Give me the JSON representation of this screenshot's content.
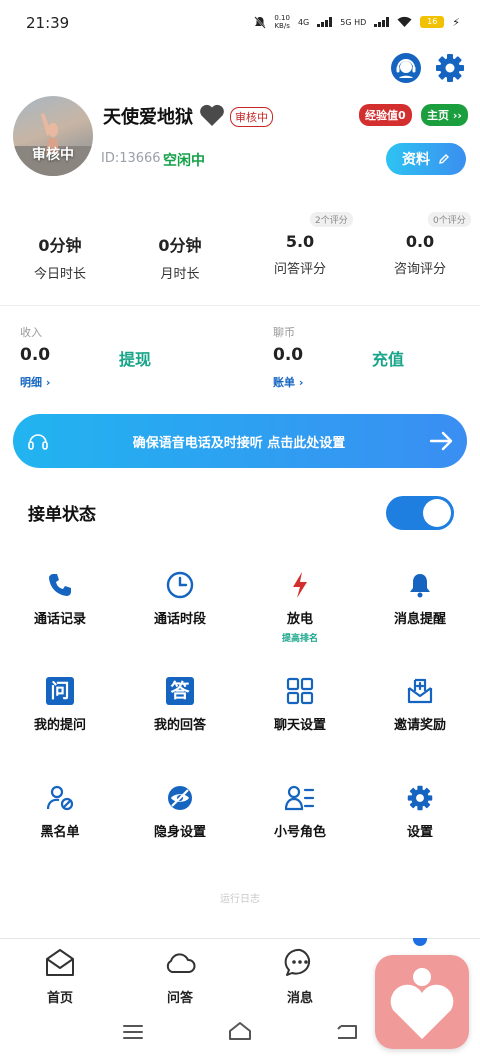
{
  "status_bar": {
    "time": "21:39",
    "net_speed_value": "0.10",
    "net_speed_unit": "KB/s",
    "signal_1": "4G",
    "signal_2": "5G HD",
    "battery": "16"
  },
  "profile": {
    "avatar_badge": "审核中",
    "nickname": "天使爱地狱",
    "review_badge": "审核中",
    "exp_badge": "经验值0",
    "home_badge": "主页 ››",
    "user_id": "ID:13666",
    "online_status": "空闲中",
    "profile_button": "资料"
  },
  "stats": [
    {
      "value": "0分钟",
      "label": "今日时长",
      "tag": ""
    },
    {
      "value": "0分钟",
      "label": "月时长",
      "tag": ""
    },
    {
      "value": "5.0",
      "label": "问答评分",
      "tag": "2个评分"
    },
    {
      "value": "0.0",
      "label": "咨询评分",
      "tag": "0个评分"
    }
  ],
  "wallet": {
    "income_label": "收入",
    "income_amount": "0.0",
    "income_link": "明细 ›",
    "withdraw": "提现",
    "coin_label": "聊币",
    "coin_amount": "0.0",
    "coin_link": "账单 ›",
    "recharge": "充值"
  },
  "banner": {
    "text": "确保语音电话及时接听 点击此处设置"
  },
  "accept": {
    "label": "接单状态",
    "enabled": true
  },
  "grid": [
    {
      "label": "通话记录",
      "icon": "phone-icon",
      "sub": ""
    },
    {
      "label": "通话时段",
      "icon": "clock-icon",
      "sub": ""
    },
    {
      "label": "放电",
      "icon": "lightning-icon",
      "sub": "提高排名"
    },
    {
      "label": "消息提醒",
      "icon": "bell-icon",
      "sub": ""
    },
    {
      "label": "我的提问",
      "icon": "question-icon",
      "sub": ""
    },
    {
      "label": "我的回答",
      "icon": "answer-icon",
      "sub": ""
    },
    {
      "label": "聊天设置",
      "icon": "grid-settings-icon",
      "sub": ""
    },
    {
      "label": "邀请奖励",
      "icon": "invite-icon",
      "sub": ""
    },
    {
      "label": "黑名单",
      "icon": "blacklist-icon",
      "sub": ""
    },
    {
      "label": "隐身设置",
      "icon": "invisible-icon",
      "sub": ""
    },
    {
      "label": "小号角色",
      "icon": "alt-account-icon",
      "sub": ""
    },
    {
      "label": "设置",
      "icon": "settings-icon",
      "sub": ""
    }
  ],
  "grid_icon_glyphs": {
    "question": "问",
    "answer": "答"
  },
  "log_text": "运行日志",
  "bottom_nav": [
    {
      "label": "首页",
      "icon": "home-icon"
    },
    {
      "label": "问答",
      "icon": "cloud-icon"
    },
    {
      "label": "消息",
      "icon": "chat-icon"
    }
  ],
  "colors": {
    "primary_blue": "#1f6fe0",
    "icon_blue": "#1565c0",
    "teal": "#1aa58a",
    "online_green": "#14a14a",
    "badge_red": "#d32f2f",
    "lightning_red": "#d32f2f"
  }
}
